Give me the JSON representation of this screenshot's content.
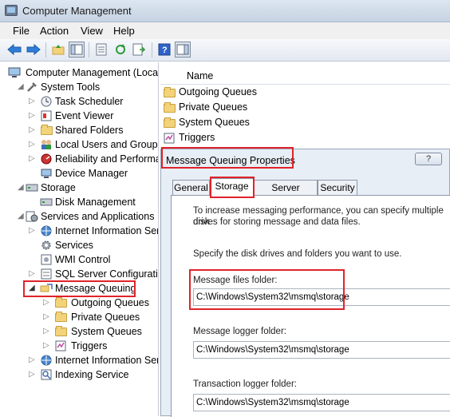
{
  "window": {
    "title": "Computer Management"
  },
  "menu": [
    "File",
    "Action",
    "View",
    "Help"
  ],
  "toolbar": {
    "buttons": [
      "back-icon",
      "forward-icon",
      "up-folder-icon",
      "show-hide-tree-icon",
      "properties-icon",
      "refresh-icon",
      "export-list-icon",
      "help-icon",
      "show-hide-action-pane-icon"
    ]
  },
  "tree": {
    "items": [
      {
        "label": "Computer Management (Local",
        "icon": "computer-management-icon"
      },
      {
        "label": "System Tools",
        "icon": "system-tools-icon"
      },
      {
        "label": "Task Scheduler",
        "icon": "clock-icon"
      },
      {
        "label": "Event Viewer",
        "icon": "event-viewer-icon"
      },
      {
        "label": "Shared Folders",
        "icon": "shared-folder-icon"
      },
      {
        "label": "Local Users and Groups",
        "icon": "users-icon"
      },
      {
        "label": "Reliability and Performa",
        "icon": "performance-icon"
      },
      {
        "label": "Device Manager",
        "icon": "device-manager-icon"
      },
      {
        "label": "Storage",
        "icon": "storage-icon"
      },
      {
        "label": "Disk Management",
        "icon": "disk-icon"
      },
      {
        "label": "Services and Applications",
        "icon": "services-apps-icon"
      },
      {
        "label": "Internet Information Ser",
        "icon": "iis-icon"
      },
      {
        "label": "Services",
        "icon": "gear-icon"
      },
      {
        "label": "WMI Control",
        "icon": "wmi-icon"
      },
      {
        "label": "SQL Server Configuratio",
        "icon": "sql-icon"
      },
      {
        "label": "Message Queuing",
        "icon": "message-queuing-icon"
      },
      {
        "label": "Outgoing Queues",
        "icon": "folder-icon"
      },
      {
        "label": "Private Queues",
        "icon": "folder-icon"
      },
      {
        "label": "System Queues",
        "icon": "folder-icon"
      },
      {
        "label": "Triggers",
        "icon": "triggers-icon"
      },
      {
        "label": "Internet Information Ser",
        "icon": "iis-icon"
      },
      {
        "label": "Indexing Service",
        "icon": "indexing-icon"
      }
    ]
  },
  "list": {
    "header": "Name",
    "items": [
      "Outgoing Queues",
      "Private Queues",
      "System Queues",
      "Triggers"
    ]
  },
  "dialog": {
    "title": "Message Queuing Properties",
    "help": "?",
    "tabs": [
      "General",
      "Storage",
      "Server Security",
      "Security"
    ],
    "active_tab": "Storage",
    "intro_line1": "To increase messaging performance, you can specify multiple disk",
    "intro_line2": "drives for storing message and data files.",
    "instruction": "Specify the disk drives and folders you want to use.",
    "message_files_label": "Message files folder:",
    "message_files_value": "C:\\Windows\\System32\\msmq\\storage",
    "logger_label": "Message logger folder:",
    "logger_value": "C:\\Windows\\System32\\msmq\\storage",
    "transaction_label": "Transaction logger folder:",
    "transaction_value": "C:\\Windows\\System32\\msmq\\storage"
  }
}
